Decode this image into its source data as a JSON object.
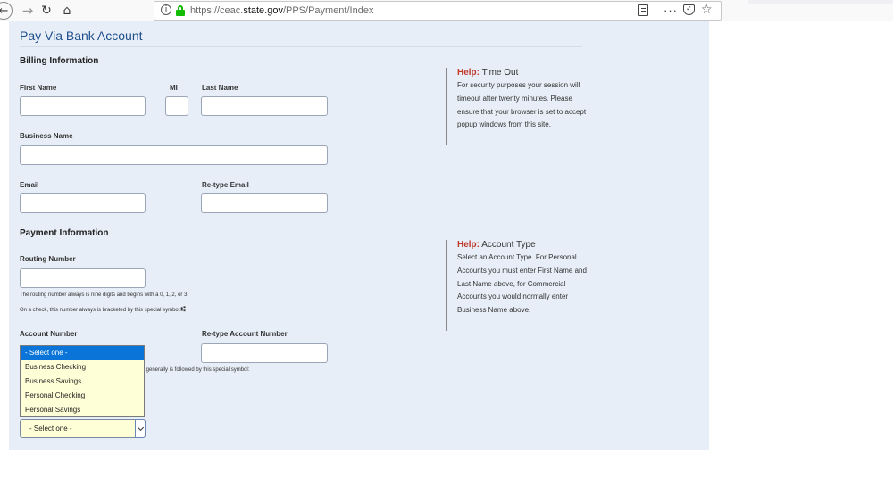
{
  "browser": {
    "url_prefix": "https://ceac.",
    "url_domain": "state.gov",
    "url_path": "/PPS/Payment/Index",
    "icons": [
      "back-icon",
      "forward-icon",
      "reload-icon",
      "home-icon",
      "info-icon",
      "lock-icon",
      "reader-view-icon",
      "more-icon",
      "pocket-icon",
      "bookmark-star-icon"
    ],
    "glyphs": {
      "back": "←",
      "forward": "→",
      "reload": "↻",
      "home": "⌂",
      "info": "i",
      "more": "···",
      "star": "☆",
      "pocket": "✓"
    }
  },
  "page": {
    "title": "Pay Via Bank Account"
  },
  "billing": {
    "heading": "Billing Information",
    "first_name_label": "First Name",
    "mi_label": "MI",
    "last_name_label": "Last Name",
    "business_name_label": "Business Name",
    "email_label": "Email",
    "retype_email_label": "Re-type Email",
    "first_name_value": "",
    "mi_value": "",
    "last_name_value": "",
    "business_name_value": "",
    "email_value": "",
    "retype_email_value": ""
  },
  "payment": {
    "heading": "Payment Information",
    "routing_label": "Routing Number",
    "routing_value": "",
    "routing_note_1": "The routing number always is nine digits and begins with a 0, 1, 2, or 3.",
    "routing_note_2": "On a check, this number always is bracketed by this special symbol:",
    "routing_symbol": "⑆",
    "account_label": "Account Number",
    "retype_account_label": "Re-type Account Number",
    "retype_account_value": "",
    "account_note_tail": "r generally is followed by this special symbol:",
    "account_type_options": [
      "- Select one -",
      "Business Checking",
      "Business Savings",
      "Personal Checking",
      "Personal Savings"
    ],
    "account_type_selected": "- Select one -"
  },
  "help_timeout": {
    "prefix": "Help:",
    "title": "Time Out",
    "body": "For security purposes your session will timeout after twenty minutes. Please ensure that your browser is set to accept popup windows from this site."
  },
  "help_account": {
    "prefix": "Help:",
    "title": "Account Type",
    "body": "Select an Account Type. For Personal Accounts you must enter First Name and Last Name above, for Commercial Accounts you would normally enter Business Name above."
  },
  "colors": {
    "page_bg": "#e7eef7",
    "title": "#1f4f8c",
    "help_accent": "#c0392b",
    "dropdown_bg": "#ffffd7",
    "dropdown_highlight": "#0a74d9"
  }
}
